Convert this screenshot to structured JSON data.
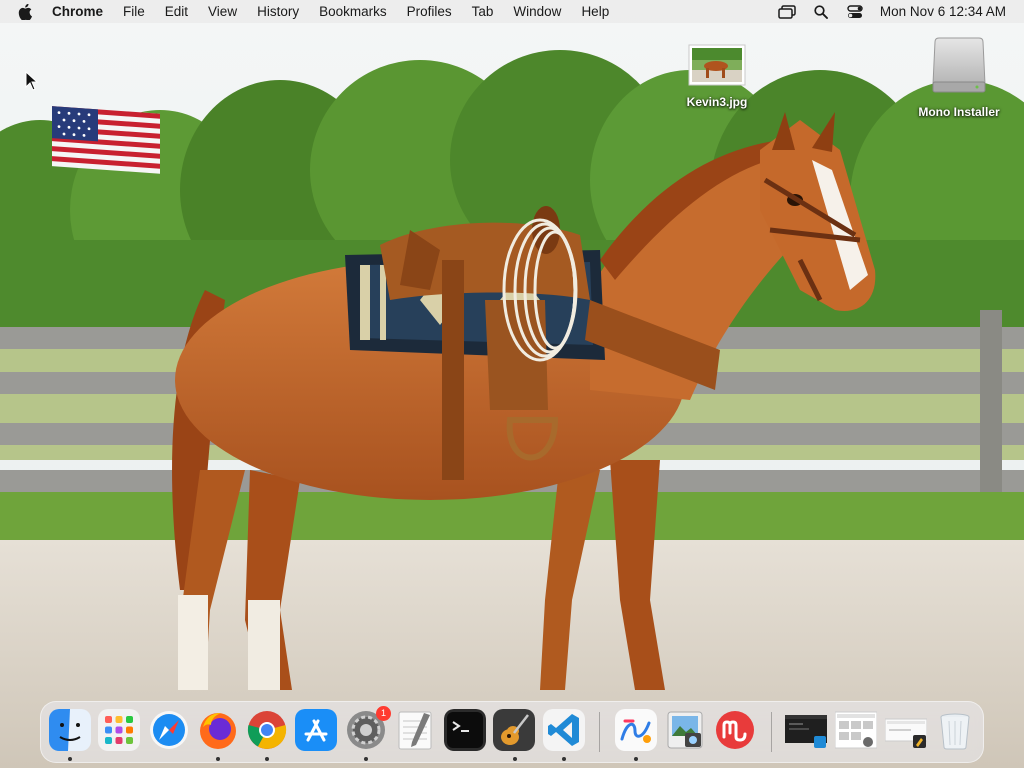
{
  "menubar": {
    "app_name": "Chrome",
    "items": [
      "File",
      "Edit",
      "View",
      "History",
      "Bookmarks",
      "Profiles",
      "Tab",
      "Window",
      "Help"
    ],
    "status_icons": [
      "screen-mirroring-icon",
      "spotlight-search-icon",
      "control-center-icon"
    ],
    "clock": "Mon Nov 6  12:34 AM"
  },
  "desktop": {
    "files": [
      {
        "label": "Kevin3.jpg",
        "icon": "image-file-icon"
      },
      {
        "label": "Mono Installer",
        "icon": "disk-image-icon"
      }
    ],
    "widgets": [
      "american-flag"
    ]
  },
  "dock": {
    "apps": [
      {
        "name": "Finder",
        "icon": "finder-icon",
        "running": true
      },
      {
        "name": "Launchpad",
        "icon": "launchpad-icon",
        "running": false
      },
      {
        "name": "Safari",
        "icon": "safari-icon",
        "running": false
      },
      {
        "name": "Firefox",
        "icon": "firefox-icon",
        "running": true
      },
      {
        "name": "Google Chrome",
        "icon": "chrome-icon",
        "running": true
      },
      {
        "name": "App Store",
        "icon": "app-store-icon",
        "running": false
      },
      {
        "name": "System Preferences",
        "icon": "system-preferences-icon",
        "running": true,
        "badge": "1"
      },
      {
        "name": "TextEdit",
        "icon": "textedit-icon",
        "running": false
      },
      {
        "name": "Terminal",
        "icon": "terminal-icon",
        "running": false
      },
      {
        "name": "GarageBand",
        "icon": "garageband-icon",
        "running": true
      },
      {
        "name": "Visual Studio Code",
        "icon": "vscode-icon",
        "running": true
      },
      {
        "name": "Freeform",
        "icon": "freeform-icon",
        "running": true
      },
      {
        "name": "Preview",
        "icon": "preview-icon",
        "running": false
      },
      {
        "name": "Mono",
        "icon": "mono-icon",
        "running": false
      }
    ],
    "recent": [
      {
        "name": "VS Code window",
        "icon": "vscode-window-thumbnail-icon"
      },
      {
        "name": "Document window",
        "icon": "document-window-thumbnail-icon"
      },
      {
        "name": "Installer window",
        "icon": "installer-window-thumbnail-icon"
      },
      {
        "name": "Trash",
        "icon": "trash-icon"
      }
    ]
  }
}
